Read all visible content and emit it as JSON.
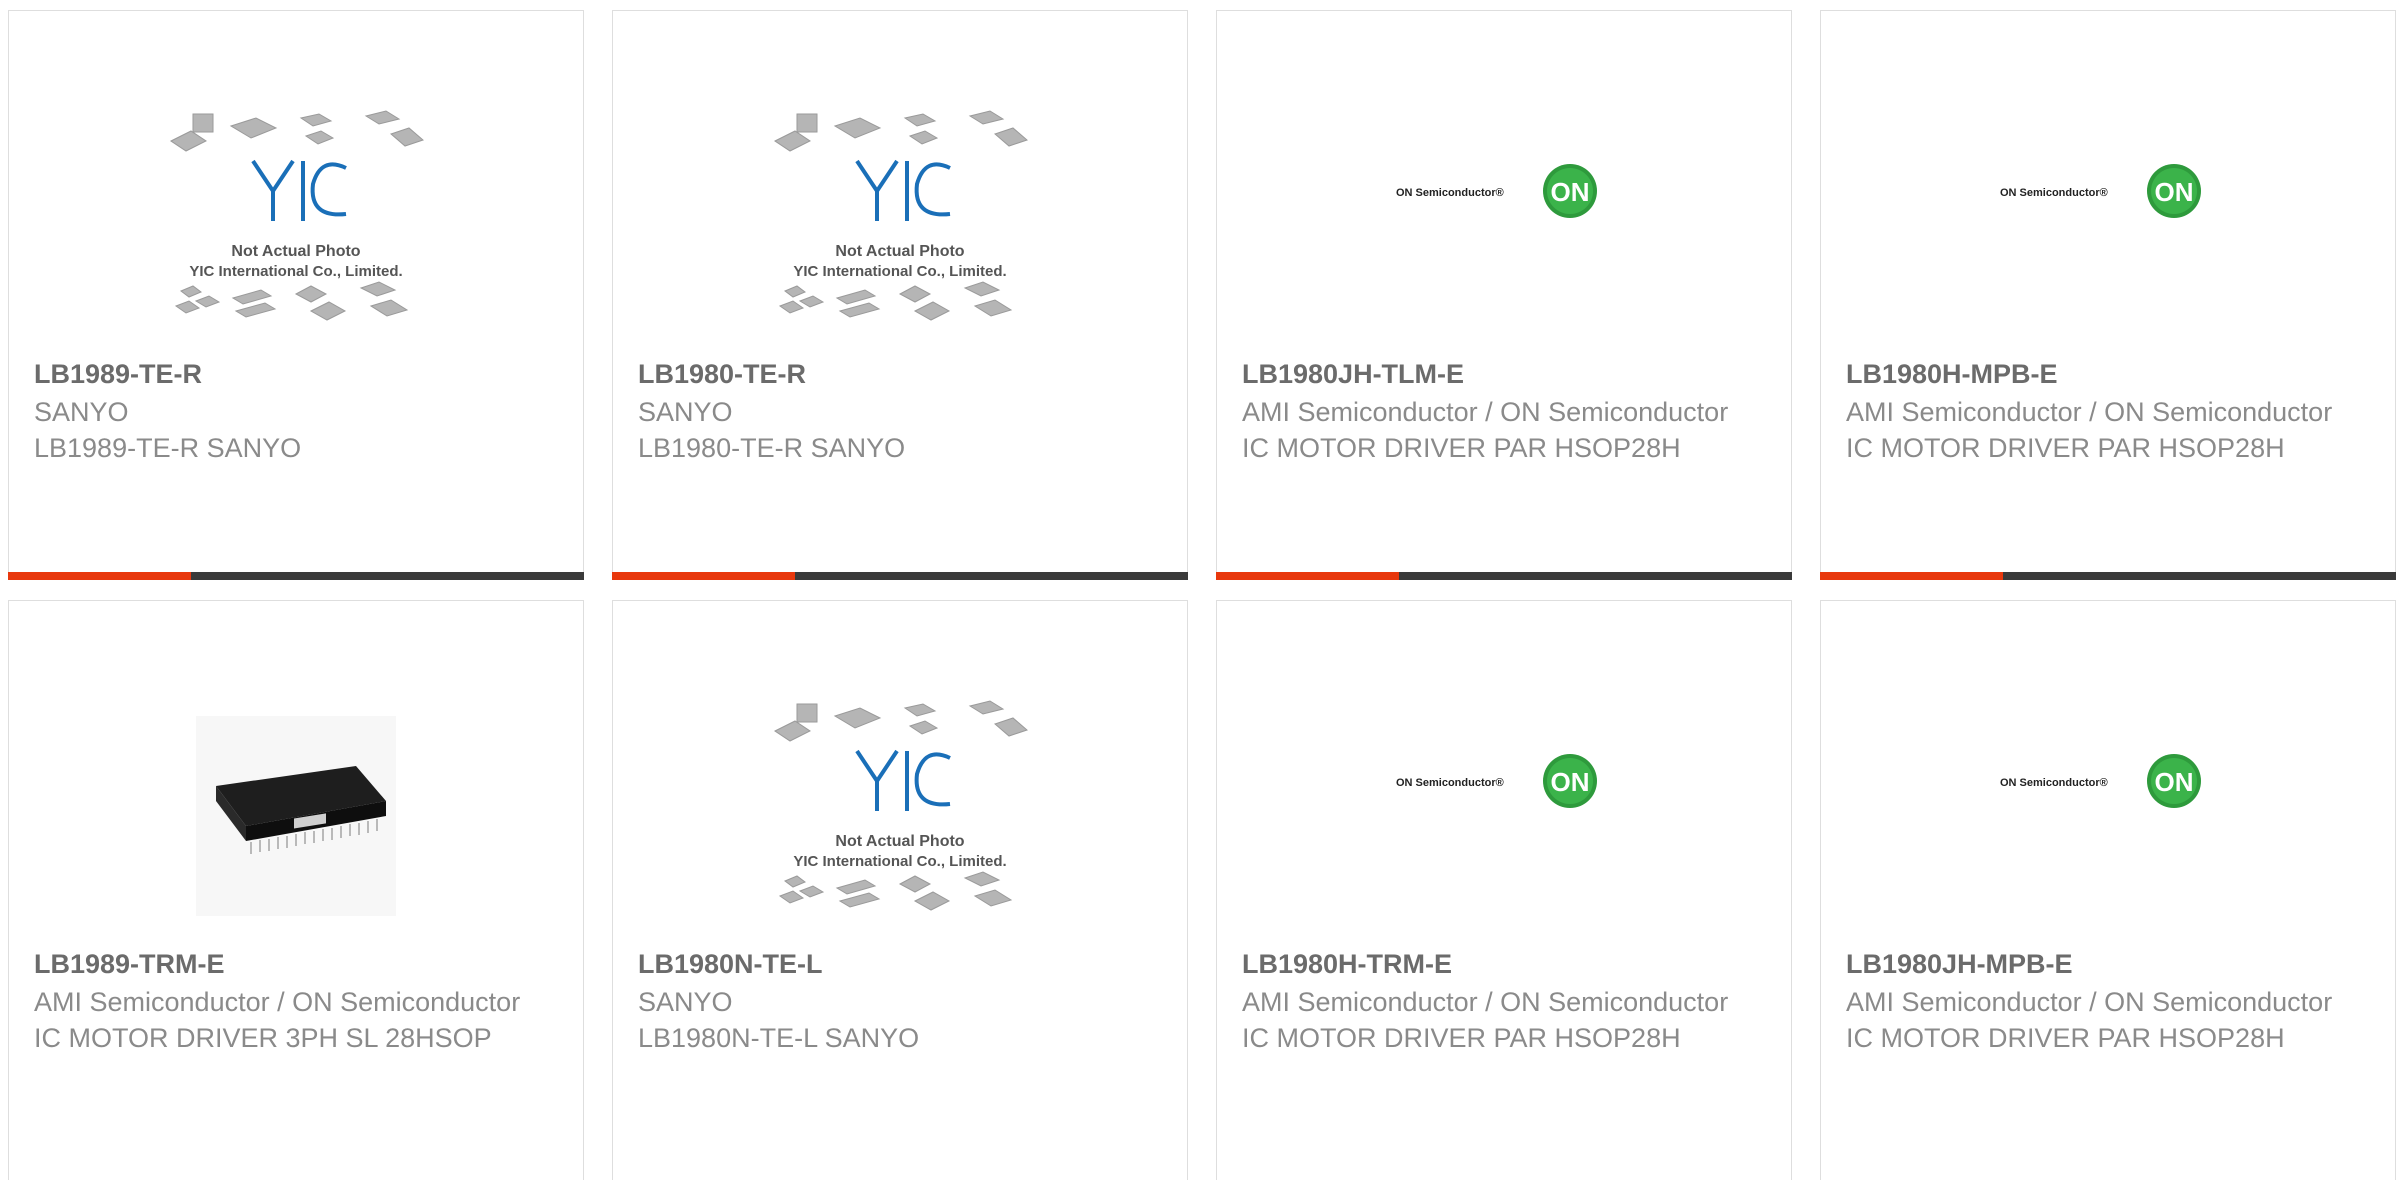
{
  "colors": {
    "accent": "#e8380d",
    "bar_dark": "#3a3a3a",
    "on_green": "#2e9a3c",
    "yic_blue": "#1a6fb8"
  },
  "products": [
    {
      "pn": "LB1989-TE-R",
      "mfr": "SANYO",
      "desc": "LB1989-TE-R SANYO",
      "image": "yic",
      "image_text": {
        "line1": "Not Actual Photo",
        "line2": "YIC International Co., Limited.",
        "logo": "YIC"
      }
    },
    {
      "pn": "LB1980-TE-R",
      "mfr": "SANYO",
      "desc": "LB1980-TE-R SANYO",
      "image": "yic",
      "image_text": {
        "line1": "Not Actual Photo",
        "line2": "YIC International Co., Limited.",
        "logo": "YIC"
      }
    },
    {
      "pn": "LB1980JH-TLM-E",
      "mfr": "AMI Semiconductor / ON Semiconductor",
      "desc": "IC MOTOR DRIVER PAR HSOP28H",
      "image": "on",
      "image_text": {
        "brand": "ON Semiconductor®",
        "badge": "ON"
      }
    },
    {
      "pn": "LB1980H-MPB-E",
      "mfr": "AMI Semiconductor / ON Semiconductor",
      "desc": "IC MOTOR DRIVER PAR HSOP28H",
      "image": "on",
      "image_text": {
        "brand": "ON Semiconductor®",
        "badge": "ON"
      }
    },
    {
      "pn": "LB1989-TRM-E",
      "mfr": "AMI Semiconductor / ON Semiconductor",
      "desc": "IC MOTOR DRIVER 3PH SL 28HSOP",
      "image": "chip"
    },
    {
      "pn": "LB1980N-TE-L",
      "mfr": "SANYO",
      "desc": "LB1980N-TE-L SANYO",
      "image": "yic",
      "image_text": {
        "line1": "Not Actual Photo",
        "line2": "YIC International Co., Limited.",
        "logo": "YIC"
      }
    },
    {
      "pn": "LB1980H-TRM-E",
      "mfr": "AMI Semiconductor / ON Semiconductor",
      "desc": "IC MOTOR DRIVER PAR HSOP28H",
      "image": "on",
      "image_text": {
        "brand": "ON Semiconductor®",
        "badge": "ON"
      }
    },
    {
      "pn": "LB1980JH-MPB-E",
      "mfr": "AMI Semiconductor / ON Semiconductor",
      "desc": "IC MOTOR DRIVER PAR HSOP28H",
      "image": "on",
      "image_text": {
        "brand": "ON Semiconductor®",
        "badge": "ON"
      }
    }
  ]
}
